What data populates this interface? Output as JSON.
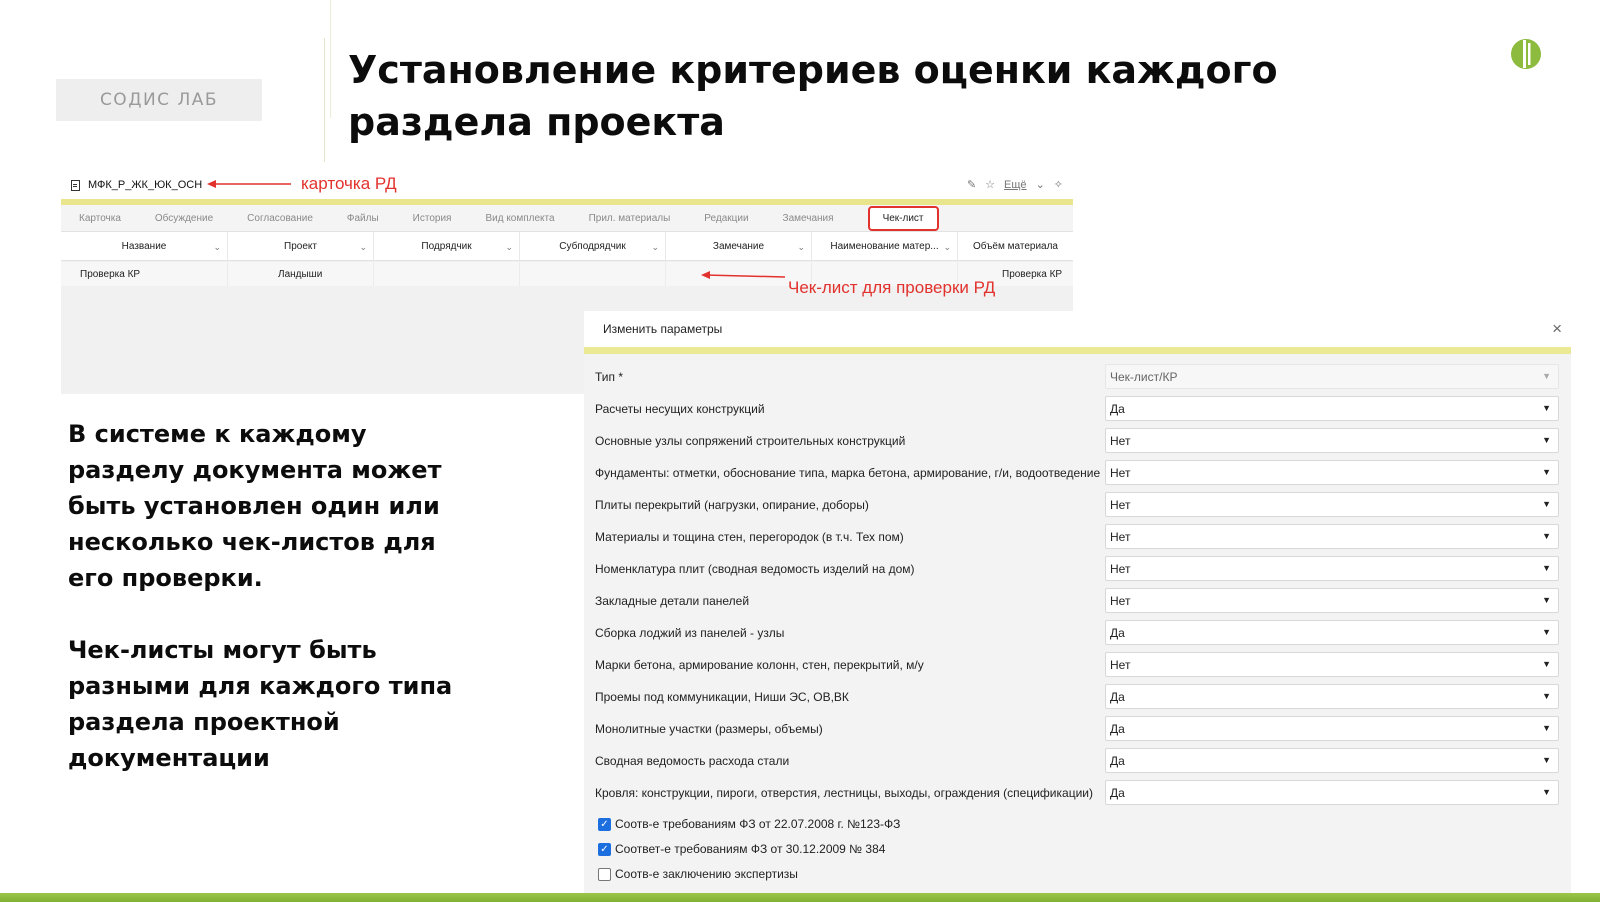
{
  "slide": {
    "logo_text": "СОДИС ЛАБ",
    "title": "Установление критериев оценки каждого раздела проекта",
    "paragraph1": "В системе к каждому разделу документа может быть установлен один или несколько чек-листов для его проверки.",
    "paragraph2": "Чек-листы могут быть разными для каждого типа раздела проектной документации"
  },
  "document": {
    "name": "МФК_Р_ЖК_ЮК_ОСН",
    "more_label": "Ещё",
    "annotation_card": "карточка РД",
    "annotation_checklist": "Чек-лист для проверки РД"
  },
  "tabs": [
    "Карточка",
    "Обсуждение",
    "Согласование",
    "Файлы",
    "История",
    "Вид комплекта",
    "Прил. материалы",
    "Редакции",
    "Замечания"
  ],
  "active_tab": "Чек-лист",
  "grid": {
    "columns": [
      "Название",
      "Проект",
      "Подрядчик",
      "Субподрядчик",
      "Замечание",
      "Наименование матер...",
      "Объём материала"
    ],
    "row": [
      "Проверка КР",
      "Ландыши",
      "",
      "",
      "",
      "",
      "Проверка КР"
    ]
  },
  "dialog": {
    "title": "Изменить параметры",
    "type_label": "Тип *",
    "type_value": "Чек-лист/КР",
    "fields": [
      {
        "label": "Расчеты несущих конструкций",
        "value": "Да"
      },
      {
        "label": "Основные узлы сопряжений строительных конструкций",
        "value": "Нет"
      },
      {
        "label": "Фундаменты: отметки, обоснование типа, марка бетона, армирование, г/и, водоотведение",
        "value": "Нет"
      },
      {
        "label": "Плиты перекрытий (нагрузки, опирание, доборы)",
        "value": "Нет"
      },
      {
        "label": "Материалы и тощина стен, перегородок (в т.ч. Тех пом)",
        "value": "Нет"
      },
      {
        "label": "Номенклатура плит (сводная ведомость изделий на дом)",
        "value": "Нет"
      },
      {
        "label": "Закладные детали панелей",
        "value": "Нет"
      },
      {
        "label": "Сборка лоджий из панелей - узлы",
        "value": "Да"
      },
      {
        "label": "Марки бетона, армирование колонн, стен, перекрытий, м/у",
        "value": "Нет"
      },
      {
        "label": "Проемы под коммуникации, Ниши ЭС, ОВ,ВК",
        "value": "Да"
      },
      {
        "label": "Монолитные участки (размеры, объемы)",
        "value": "Да"
      },
      {
        "label": "Сводная ведомость расхода стали",
        "value": "Да"
      },
      {
        "label": "Кровля: конструкции, пироги, отверстия, лестницы, выходы, ограждения (спецификации)",
        "value": "Да"
      }
    ],
    "checkboxes": [
      {
        "label": "Соотв-е требованиям ФЗ от 22.07.2008 г. №123-ФЗ",
        "checked": true
      },
      {
        "label": "Соответ-е требованиям ФЗ от 30.12.2009 № 384",
        "checked": true
      },
      {
        "label": "Соотв-е заключению экспертизы",
        "checked": false
      }
    ]
  },
  "colors": {
    "accent_red": "#e2322d",
    "yellow_bar": "#e8e58c",
    "brand_green": "#8dbb3e",
    "checkbox_blue": "#1d6fe0"
  }
}
